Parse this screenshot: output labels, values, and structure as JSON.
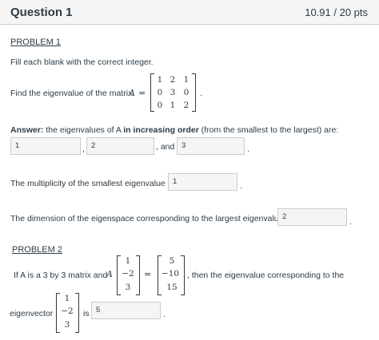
{
  "question": {
    "title": "Question 1",
    "points": "10.91 / 20 pts"
  },
  "problem1": {
    "heading": "PROBLEM 1",
    "instructions": "Fill each blank with the correct integer.",
    "find_text": "Find the eigenvalue of the matrix",
    "matrix_var": "A",
    "equals": "=",
    "matrix": [
      [
        "1",
        "2",
        "1"
      ],
      [
        "0",
        "3",
        "0"
      ],
      [
        "0",
        "1",
        "2"
      ]
    ],
    "period": ".",
    "answer_label": "Answer:",
    "answer_text_1": " the eigenvalues of A ",
    "answer_bold": "in increasing order",
    "answer_text_2": " (from the smallest to the largest) are:",
    "eig_values": [
      "1",
      "2",
      "3"
    ],
    "comma": ",",
    "and_text": ", and",
    "mult_text": "The multiplicity of the smallest eigenvalue is",
    "mult_value": "1",
    "dim_text": "The dimension of the eigenspace corresponding to the largest eigenvalue is",
    "dim_value": "2"
  },
  "problem2": {
    "heading": "PROBLEM 2",
    "text_1": "If A is a 3 by 3 matrix and",
    "matrix_var": "A",
    "vec1": [
      "1",
      "−2",
      "3"
    ],
    "equals": "=",
    "vec2": [
      "5",
      "−10",
      "15"
    ],
    "text_2": ", then the eigenvalue corresponding to the",
    "text_3": "eigenvector",
    "vec3": [
      "1",
      "−2",
      "3"
    ],
    "is_text": "is",
    "answer_value": "5",
    "period": "."
  }
}
